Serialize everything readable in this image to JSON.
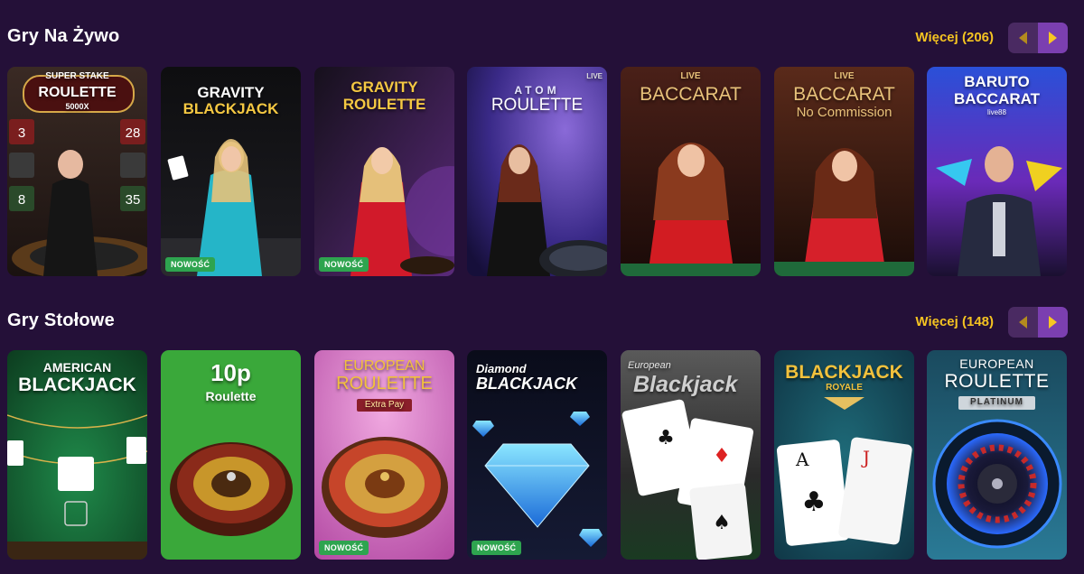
{
  "colors": {
    "background": "#241038",
    "accent_gold": "#f4c321",
    "nav_next": "#7b3fb0",
    "nav_prev": "#4a2a62",
    "badge_green": "#2ea44f"
  },
  "sections": [
    {
      "title": "Gry Na Żywo",
      "more_label": "Więcej (206)",
      "prev_icon": "chevron-left-icon",
      "next_icon": "chevron-right-icon",
      "games": [
        {
          "top": "SUPER STAKE",
          "title": "ROULETTE",
          "sub": "5000X",
          "badge": ""
        },
        {
          "title": "GRAVITY",
          "sub": "BLACKJACK",
          "badge": "NOWOŚĆ"
        },
        {
          "title": "GRAVITY",
          "sub": "ROULETTE",
          "badge": "NOWOŚĆ"
        },
        {
          "top": "LIVE",
          "title": "ATOM",
          "sub": "ROULETTE",
          "badge": ""
        },
        {
          "top": "LIVE",
          "title": "BACCARAT",
          "badge": ""
        },
        {
          "top": "LIVE",
          "title": "BACCARAT",
          "sub": "No Commission",
          "badge": ""
        },
        {
          "title": "BARUTO",
          "sub": "BACCARAT",
          "extra": "live88",
          "badge": ""
        }
      ]
    },
    {
      "title": "Gry Stołowe",
      "more_label": "Więcej (148)",
      "prev_icon": "chevron-left-icon",
      "next_icon": "chevron-right-icon",
      "games": [
        {
          "title": "AMERICAN",
          "sub": "BLACKJACK",
          "badge": ""
        },
        {
          "title": "10p",
          "sub": "Roulette",
          "badge": ""
        },
        {
          "title": "EUROPEAN",
          "sub": "ROULETTE",
          "extra": "Extra Pay",
          "badge": "NOWOŚĆ"
        },
        {
          "title": "Diamond",
          "sub": "BLACKJACK",
          "badge": "NOWOŚĆ"
        },
        {
          "title": "European",
          "sub": "Blackjack",
          "badge": ""
        },
        {
          "title": "BLACKJACK",
          "sub": "ROYALE",
          "badge": ""
        },
        {
          "title": "EUROPEAN",
          "sub": "ROULETTE",
          "extra": "PLATINUM",
          "badge": ""
        }
      ]
    }
  ]
}
